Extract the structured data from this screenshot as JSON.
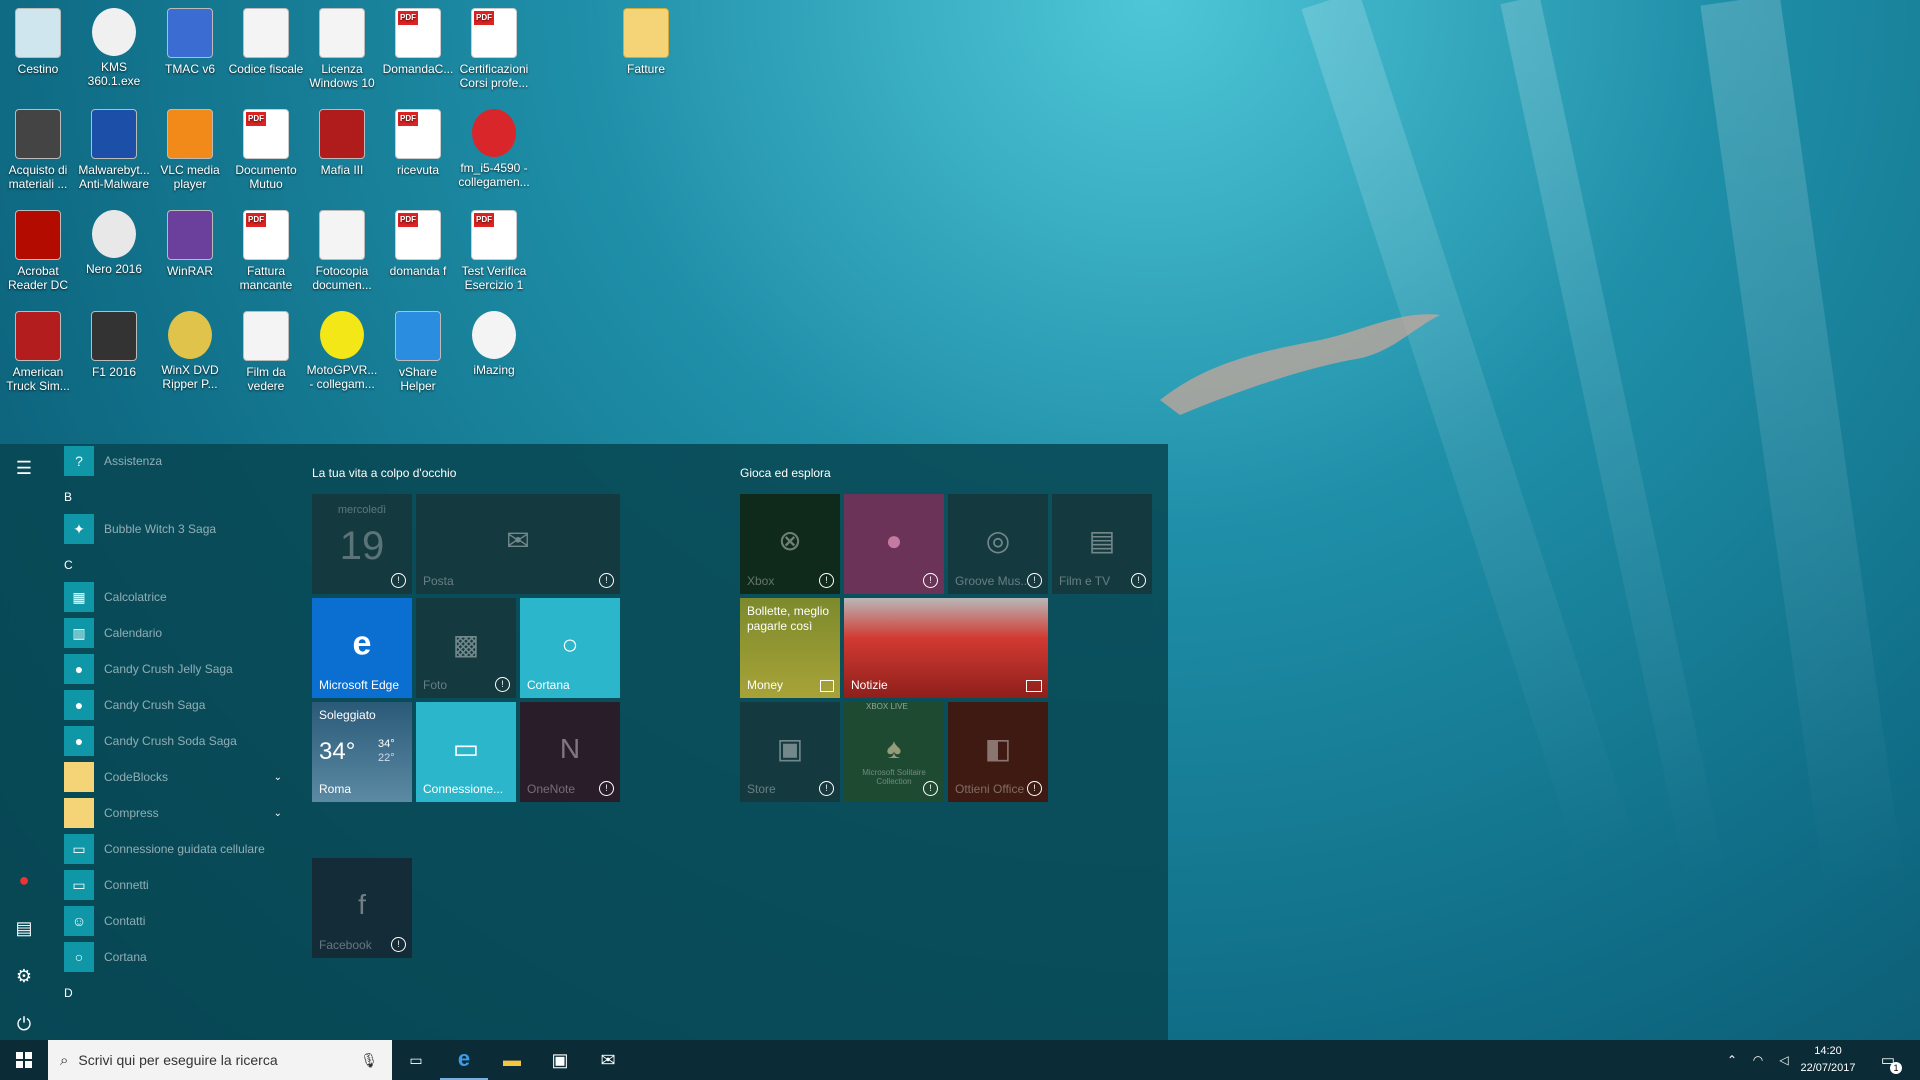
{
  "desktop": {
    "icons": [
      {
        "label": "Cestino",
        "kind": "doc",
        "color": "#cfe6ef"
      },
      {
        "label": "KMS 360.1.exe",
        "kind": "round",
        "color": "#f0f0f0"
      },
      {
        "label": "TMAC v6",
        "kind": "doc",
        "color": "#3b6cd1"
      },
      {
        "label": "Codice fiscale",
        "kind": "doc",
        "color": "#f4f4f4"
      },
      {
        "label": "Licenza Windows 10",
        "kind": "doc",
        "color": "#f4f4f4"
      },
      {
        "label": "DomandaC...",
        "kind": "pdf",
        "color": "#ffffff"
      },
      {
        "label": "Certificazioni Corsi profe...",
        "kind": "pdf",
        "color": "#ffffff"
      },
      {
        "label": "Fatture",
        "kind": "folder",
        "color": "#f5d477"
      },
      {
        "label": "Acquisto di materiali ...",
        "kind": "doc",
        "color": "#444444"
      },
      {
        "label": "Malwarebyt... Anti-Malware",
        "kind": "doc",
        "color": "#1c4fa8"
      },
      {
        "label": "VLC media player",
        "kind": "doc",
        "color": "#f28a1a"
      },
      {
        "label": "Documento Mutuo",
        "kind": "pdf",
        "color": "#ffffff"
      },
      {
        "label": "Mafia III",
        "kind": "doc",
        "color": "#b01c1c"
      },
      {
        "label": "ricevuta",
        "kind": "pdf",
        "color": "#ffffff"
      },
      {
        "label": "fm_i5-4590 - collegamen...",
        "kind": "round",
        "color": "#d9262b"
      },
      {
        "label": "Acrobat Reader DC",
        "kind": "doc",
        "color": "#b30b00"
      },
      {
        "label": "Nero 2016",
        "kind": "round",
        "color": "#e8e8e8"
      },
      {
        "label": "WinRAR",
        "kind": "doc",
        "color": "#6b3f9c"
      },
      {
        "label": "Fattura mancante",
        "kind": "pdf",
        "color": "#ffffff"
      },
      {
        "label": "Fotocopia documen...",
        "kind": "doc",
        "color": "#f4f4f4"
      },
      {
        "label": "domanda f",
        "kind": "pdf",
        "color": "#ffffff"
      },
      {
        "label": "Test Verifica Esercizio 1",
        "kind": "pdf",
        "color": "#ffffff"
      },
      {
        "label": "American Truck Sim...",
        "kind": "doc",
        "color": "#b31d1d"
      },
      {
        "label": "F1 2016",
        "kind": "doc",
        "color": "#333333"
      },
      {
        "label": "WinX DVD Ripper P...",
        "kind": "round",
        "color": "#e0c34a"
      },
      {
        "label": "Film da vedere",
        "kind": "doc",
        "color": "#f4f4f4"
      },
      {
        "label": "MotoGPVR... - collegam...",
        "kind": "round",
        "color": "#f3e718"
      },
      {
        "label": "vShare Helper",
        "kind": "doc",
        "color": "#2b8de0"
      },
      {
        "label": "iMazing",
        "kind": "round",
        "color": "#f4f4f4"
      }
    ]
  },
  "start_menu": {
    "rail": {
      "menu": "☰",
      "user": "●",
      "documents": "▤",
      "settings": "⚙",
      "power": "⏻"
    },
    "apps": [
      {
        "type": "app",
        "label": "Assistenza",
        "icon": "?"
      },
      {
        "type": "letter",
        "label": "B"
      },
      {
        "type": "app",
        "label": "Bubble Witch 3 Saga",
        "icon": "✦"
      },
      {
        "type": "letter",
        "label": "C"
      },
      {
        "type": "app",
        "label": "Calcolatrice",
        "icon": "▦"
      },
      {
        "type": "app",
        "label": "Calendario",
        "icon": "▥"
      },
      {
        "type": "app",
        "label": "Candy Crush Jelly Saga",
        "icon": "●"
      },
      {
        "type": "app",
        "label": "Candy Crush Saga",
        "icon": "●"
      },
      {
        "type": "app",
        "label": "Candy Crush Soda Saga",
        "icon": "●"
      },
      {
        "type": "folder",
        "label": "CodeBlocks",
        "icon": "▮"
      },
      {
        "type": "folder",
        "label": "Compress",
        "icon": "▮"
      },
      {
        "type": "app",
        "label": "Connessione guidata cellulare",
        "icon": "▭"
      },
      {
        "type": "app",
        "label": "Connetti",
        "icon": "▭"
      },
      {
        "type": "app",
        "label": "Contatti",
        "icon": "☺"
      },
      {
        "type": "app",
        "label": "Cortana",
        "icon": "○"
      },
      {
        "type": "letter",
        "label": "D"
      }
    ],
    "group1": {
      "title": "La tua vita a colpo d'occhio",
      "calendar": {
        "day": "mercoledì",
        "date": "19"
      },
      "mail": "Posta",
      "edge": "Microsoft Edge",
      "photos": "Foto",
      "cortana": "Cortana",
      "weather": {
        "condition": "Soleggiato",
        "temp": "34°",
        "high": "34°",
        "low": "22°",
        "city": "Roma"
      },
      "connect": "Connessione...",
      "onenote": "OneNote",
      "facebook": "Facebook"
    },
    "group2": {
      "title": "Gioca ed esplora",
      "xbox": "Xbox",
      "groove": "Groove Mus...",
      "films": "Film e TV",
      "money_headline": "Bollette, meglio pagarle così",
      "money": "Money",
      "news": "Notizie",
      "store": "Store",
      "solitaire_badge": "XBOX LIVE",
      "solitaire": "Microsoft Solitaire Collection",
      "office": "Ottieni Office"
    }
  },
  "taskbar": {
    "search_placeholder": "Scrivi qui per eseguire la ricerca",
    "time": "14:20",
    "date": "22/07/2017",
    "notifications": "1"
  },
  "colors": {
    "edge": "#0a6fd0",
    "cortana": "#2bb6cc",
    "taskbar": "#0b2c36"
  }
}
